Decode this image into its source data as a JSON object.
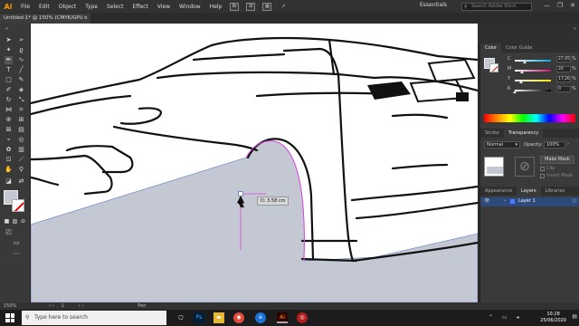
{
  "app": {
    "logo": "Ai",
    "workspace": "Essentials",
    "search_placeholder": "Search Adobe Stock"
  },
  "menu": [
    "File",
    "Edit",
    "Object",
    "Type",
    "Select",
    "Effect",
    "View",
    "Window",
    "Help"
  ],
  "menubar_icons": {
    "bridge": "Br",
    "stock": "St"
  },
  "window_controls": [
    "—",
    "❐",
    "✕"
  ],
  "document_tab": {
    "title": "Untitled-1* @ 150% (CMYK/GPU Preview)",
    "close": "×"
  },
  "color_panel": {
    "tabs": [
      "Color",
      "Color Guide"
    ],
    "sliders": [
      {
        "label": "C",
        "value": "27,45",
        "unit": "%",
        "fraction": 0.27,
        "gradient": "#00a0e0"
      },
      {
        "label": "M",
        "value": "20",
        "unit": "%",
        "fraction": 0.2,
        "gradient": "#e0007a"
      },
      {
        "label": "Y",
        "value": "17,26",
        "unit": "%",
        "fraction": 0.17,
        "gradient": "#ffe600"
      },
      {
        "label": "K",
        "value": "0",
        "unit": "%",
        "fraction": 0.0,
        "gradient": "#000000"
      }
    ]
  },
  "transparency_panel": {
    "tabs": [
      "Stroke",
      "Transparency"
    ],
    "blend_mode": "Normal",
    "opacity_label": "Opacity:",
    "opacity_value": "100%",
    "make_mask": "Make Mask",
    "clip": "Clip",
    "invert_mask": "Invert Mask"
  },
  "layers_panel": {
    "tabs": [
      "Appearance",
      "Layers",
      "Libraries"
    ],
    "layer_name": "Layer 1"
  },
  "measure_tooltip": "D: 3.58 cm",
  "statusbar": {
    "zoom": "150%",
    "artboard": "1",
    "tool": "Pen"
  },
  "taskbar": {
    "search_placeholder": "Type here to search",
    "time": "10:28",
    "date": "25/06/2020"
  },
  "colors": {
    "fill": "#c4c8d2",
    "path_highlight": "#e040e0",
    "accent": "#ff9a00"
  }
}
